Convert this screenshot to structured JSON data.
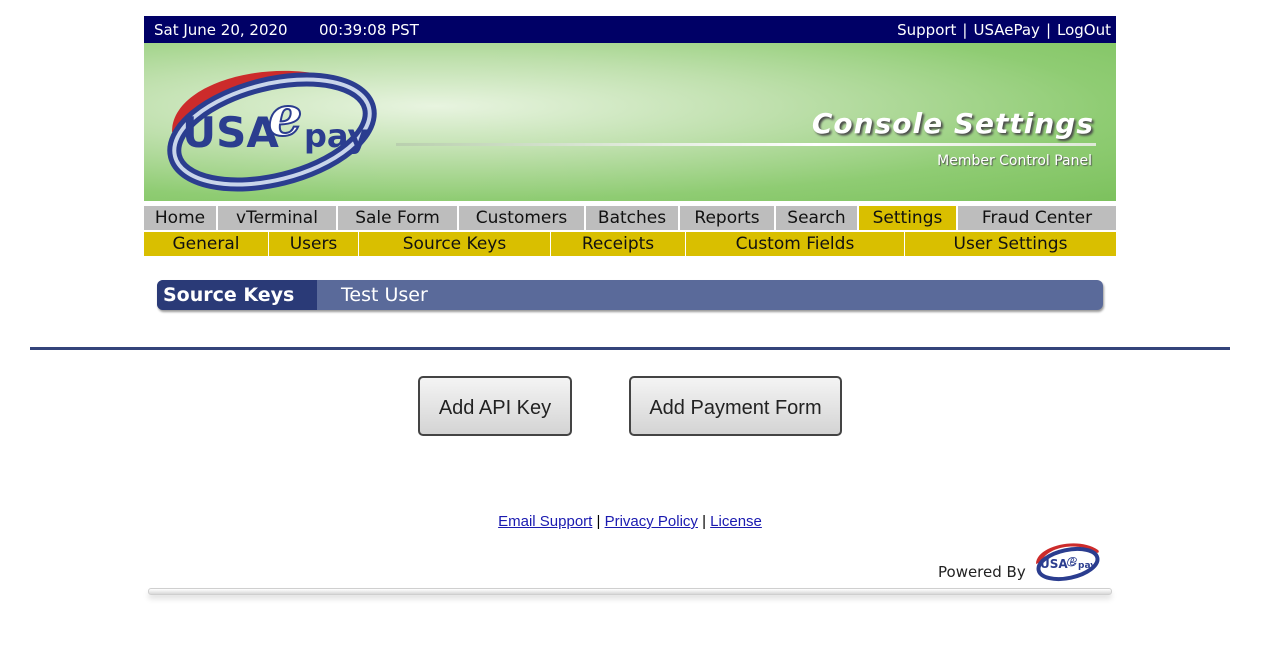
{
  "topbar": {
    "date": "Sat June 20, 2020",
    "time": "00:39:08 PST",
    "links": [
      "Support",
      "USAePay",
      "LogOut"
    ]
  },
  "banner": {
    "logo_text": "USAepay",
    "title": "Console Settings",
    "subtitle": "Member Control Panel"
  },
  "nav_primary": [
    "Home",
    "vTerminal",
    "Sale Form",
    "Customers",
    "Batches",
    "Reports",
    "Search",
    "Settings",
    "Fraud Center"
  ],
  "nav_primary_active": "Settings",
  "nav_secondary": [
    "General",
    "Users",
    "Source Keys",
    "Receipts",
    "Custom Fields",
    "User Settings"
  ],
  "heading": {
    "section": "Source Keys",
    "user": "Test User"
  },
  "buttons": {
    "add_api_key": "Add API Key",
    "add_payment_form": "Add Payment Form"
  },
  "footer": {
    "links": [
      "Email Support",
      "Privacy Policy",
      "License"
    ],
    "powered_by": "Powered By",
    "logo_text": "USAepay"
  },
  "colors": {
    "topbar": "#000066",
    "nav_inactive": "#bdbdbd",
    "nav_active": "#d9bf00",
    "heading_bar": "#5a6a9a",
    "heading_label": "#2a3a77"
  }
}
